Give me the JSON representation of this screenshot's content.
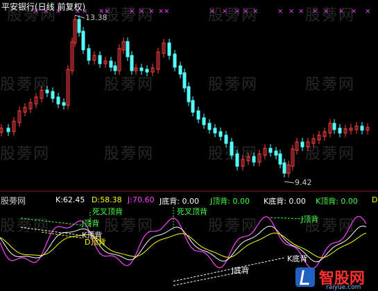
{
  "upper": {
    "title": "平安银行(日线 前复权)",
    "high_label": "13.38",
    "low_label": "9.42",
    "title_color": "#ffffff",
    "up_color": "#ff4040",
    "down_color": "#54ffff",
    "marker_color": "#ff40ff"
  },
  "lower": {
    "panel_label": "股蒡网",
    "k": {
      "label": "K:",
      "value": "62.45",
      "color": "#ffffff"
    },
    "d": {
      "label": "D:",
      "value": "58.38",
      "color": "#ffff00"
    },
    "j": {
      "label": "J:",
      "value": "70.60",
      "color": "#ff40ff"
    },
    "j_bottom_div": {
      "label": "J底背:",
      "value": "0.00",
      "color": "#ffffff"
    },
    "j_top_div": {
      "label": "J顶背:",
      "value": "0.00",
      "color": "#40ff40"
    },
    "k_bottom_div": {
      "label": "K底背:",
      "value": "0.00",
      "color": "#ffffff"
    },
    "k_top_div": {
      "label": "K顶背:",
      "value": "0.00",
      "color": "#40ff40"
    },
    "d_trunc": "D",
    "annotations": {
      "dead_cross_top_1": "死叉顶背",
      "dead_cross_top_2": "死叉顶背",
      "j_top_1": "J顶背",
      "k_top": "K顶背",
      "d_top": "D顶背",
      "j_top_2": "J顶背",
      "k_bottom": "K底背",
      "j_bottom": "J底背"
    }
  },
  "watermark": {
    "site_text": "股蒡网",
    "logo_text": "智股网",
    "logo_url": "raiyue.com"
  },
  "chart_data": {
    "type": "candlestick",
    "title": "平安银行(日线 前复权)",
    "price_high": 13.38,
    "price_low": 9.42,
    "indicator": {
      "type": "line",
      "series": [
        {
          "name": "K",
          "last": 62.45
        },
        {
          "name": "D",
          "last": 58.38
        },
        {
          "name": "J",
          "last": 70.6
        }
      ]
    }
  }
}
